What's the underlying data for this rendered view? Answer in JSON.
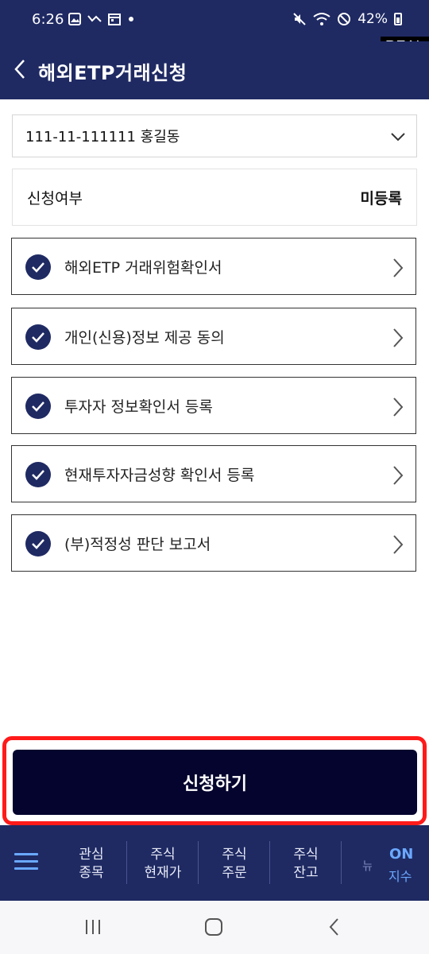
{
  "status_bar": {
    "time": "6:26",
    "battery": "42%",
    "left_icons": [
      "image-icon",
      "missed-call-icon",
      "calendar-icon",
      "dot-icon"
    ],
    "right_icons": [
      "mute-icon",
      "wifi-icon",
      "do-not-disturb-icon",
      "battery-icon"
    ]
  },
  "env_badge": "REAL",
  "header": {
    "title": "해외ETP거래신청",
    "back_icon": "chevron-left-icon"
  },
  "account": {
    "value": "111-11-111111 홍길동",
    "icon": "chevron-down-icon"
  },
  "status_row": {
    "label": "신청여부",
    "value": "미등록"
  },
  "checklist": [
    {
      "label": "해외ETP 거래위험확인서",
      "checked": true
    },
    {
      "label": "개인(신용)정보 제공 동의",
      "checked": true
    },
    {
      "label": "투자자 정보확인서 등록",
      "checked": true
    },
    {
      "label": "현재투자자금성향 확인서 등록",
      "checked": true
    },
    {
      "label": "(부)적정성 판단 보고서",
      "checked": true
    }
  ],
  "apply_button": "신청하기",
  "bottom_nav": {
    "menu_icon": "hamburger-menu-icon",
    "items": [
      {
        "line1": "관심",
        "line2": "종목"
      },
      {
        "line1": "주식",
        "line2": "현재가"
      },
      {
        "line1": "주식",
        "line2": "주문"
      },
      {
        "line1": "주식",
        "line2": "잔고"
      }
    ],
    "partial": "뉴",
    "on_label": "ON",
    "index_label": "지수"
  },
  "system_nav": [
    "recent-apps-icon",
    "home-icon",
    "back-icon"
  ],
  "colors": {
    "header_bg": "#1f2a63",
    "button_bg": "#04042e",
    "highlight_border": "#ff1a1a",
    "accent_blue": "#6aa8ff"
  }
}
